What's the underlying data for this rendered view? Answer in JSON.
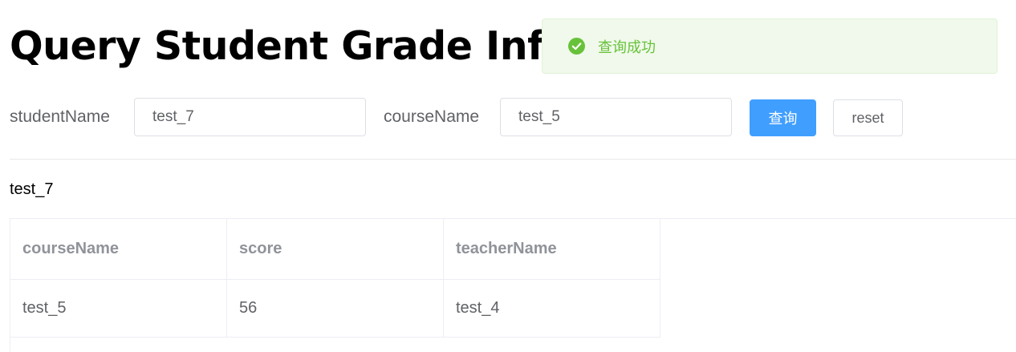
{
  "page": {
    "title": "Query Student Grade Info"
  },
  "toast": {
    "icon": "check-circle-icon",
    "message": "查询成功",
    "color": "#67c23a"
  },
  "form": {
    "student_name_label": "studentName",
    "student_name_value": "test_7",
    "course_name_label": "courseName",
    "course_name_value": "test_5",
    "query_button": "查询",
    "reset_button": "reset"
  },
  "result": {
    "student_name": "test_7",
    "columns": [
      "courseName",
      "score",
      "teacherName"
    ],
    "rows": [
      [
        "test_5",
        "56",
        "test_4"
      ]
    ]
  },
  "colors": {
    "primary": "#409eff",
    "success": "#67c23a",
    "border": "#dcdfe6"
  }
}
